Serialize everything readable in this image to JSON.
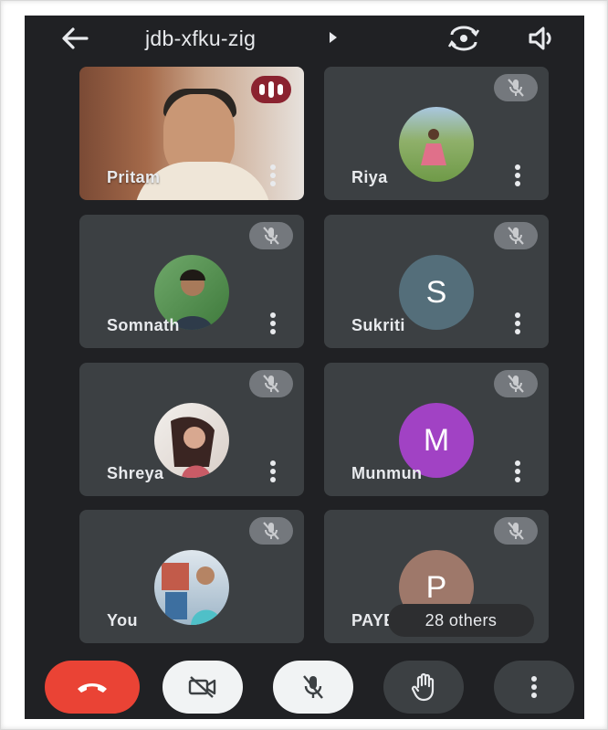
{
  "meeting": {
    "code": "jdb-xfku-zig"
  },
  "icons": {
    "back": "arrow-left-icon",
    "switch_camera": "camera-switch-icon",
    "audio_output": "speaker-icon",
    "muted": "mic-off-icon",
    "speaking": "audio-bars-icon",
    "more": "more-vert-icon",
    "end_call": "phone-hangup-icon",
    "camera": "videocam-off-icon",
    "mic": "mic-off-icon",
    "raise_hand": "hand-icon"
  },
  "participants": [
    {
      "name": "Pritam",
      "state": "video",
      "speaking": true
    },
    {
      "name": "Riya",
      "state": "muted"
    },
    {
      "name": "Somnath",
      "state": "muted"
    },
    {
      "name": "Sukriti",
      "state": "muted",
      "initial": "S",
      "avatar_color": "#546e7a"
    },
    {
      "name": "Shreya",
      "state": "muted"
    },
    {
      "name": "Munmun",
      "state": "muted",
      "initial": "M",
      "avatar_color": "#a142c4"
    },
    {
      "name": "You",
      "state": "muted"
    },
    {
      "name": "PAYEL",
      "state": "muted",
      "initial": "P",
      "avatar_color": "#9e786a"
    }
  ],
  "others_label": "28 others",
  "colors": {
    "background": "#202124",
    "tile": "#3c4043",
    "end_call": "#ea4335",
    "speaking_badge": "#8b2330"
  }
}
